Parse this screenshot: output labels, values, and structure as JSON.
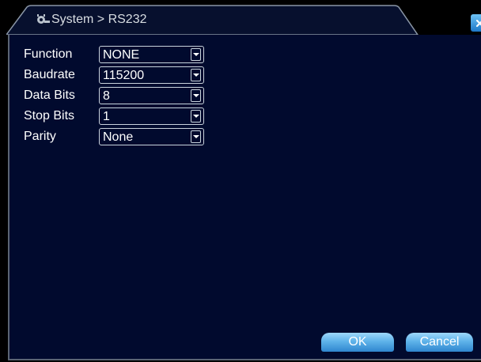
{
  "window": {
    "title": "System > RS232",
    "title_icon": "system-gear-icon",
    "close_icon": "close-x-icon"
  },
  "colors": {
    "panel_background": "#010a2e",
    "title_bar": "#07102e",
    "accent_blue": "#3a8fd6",
    "text": "#ffffff"
  },
  "fields": [
    {
      "label": "Function",
      "value": "NONE"
    },
    {
      "label": "Baudrate",
      "value": "115200"
    },
    {
      "label": "Data Bits",
      "value": "8"
    },
    {
      "label": "Stop Bits",
      "value": "1"
    },
    {
      "label": "Parity",
      "value": "None"
    }
  ],
  "buttons": {
    "ok_label": "OK",
    "cancel_label": "Cancel"
  }
}
